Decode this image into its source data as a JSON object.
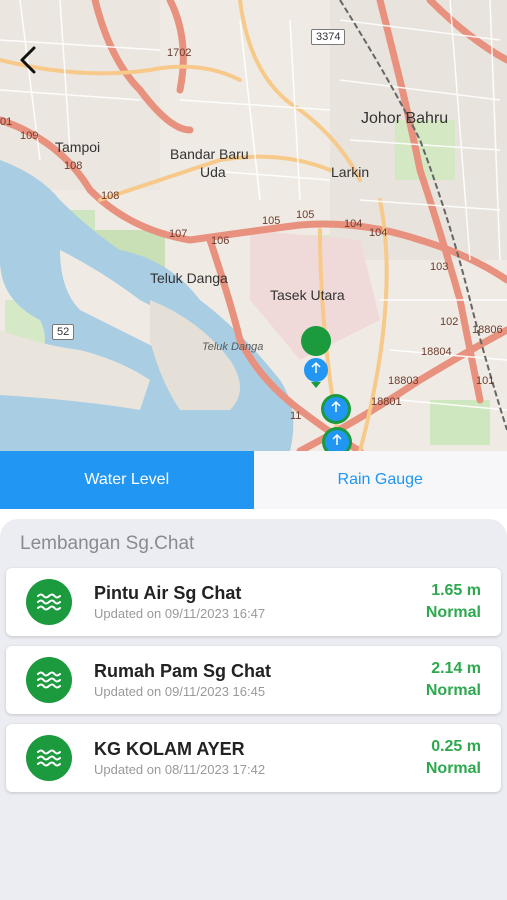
{
  "map": {
    "labels": {
      "johor_bahru": "Johor Bahru",
      "tampoi": "Tampoi",
      "bandar_baru": "Bandar Baru",
      "uda": "Uda",
      "larkin": "Larkin",
      "teluk_danga": "Teluk Danga",
      "tasek_utara": "Tasek Utara",
      "teluk_danga_water": "Teluk Danga"
    },
    "road_numbers": {
      "r3374": "3374",
      "r1702": "1702",
      "r109": "109",
      "r108a": "108",
      "r108b": "108",
      "r107": "107",
      "r106": "106",
      "r105a": "105",
      "r105b": "105",
      "r104a": "104",
      "r104b": "104",
      "r103": "103",
      "r102": "102",
      "r101": "101",
      "r52": "52",
      "r18803": "18803",
      "r18804": "18804",
      "r18801": "18801",
      "r18806": "18806",
      "r11": "11",
      "r01": "01"
    }
  },
  "tabs": {
    "water_level": "Water Level",
    "rain_gauge": "Rain Gauge"
  },
  "section": {
    "title": "Lembangan Sg.Chat"
  },
  "stations": [
    {
      "name": "Pintu Air Sg Chat",
      "updated": "Updated on 09/11/2023 16:47",
      "value": "1.65 m",
      "status": "Normal"
    },
    {
      "name": "Rumah Pam Sg Chat",
      "updated": "Updated on 09/11/2023 16:45",
      "value": "2.14 m",
      "status": "Normal"
    },
    {
      "name": "KG KOLAM AYER",
      "updated": "Updated on 08/11/2023 17:42",
      "value": "0.25 m",
      "status": "Normal"
    }
  ],
  "colors": {
    "accent": "#2196f3",
    "status_normal": "#2ea84f",
    "station_icon": "#1b9a3e"
  }
}
